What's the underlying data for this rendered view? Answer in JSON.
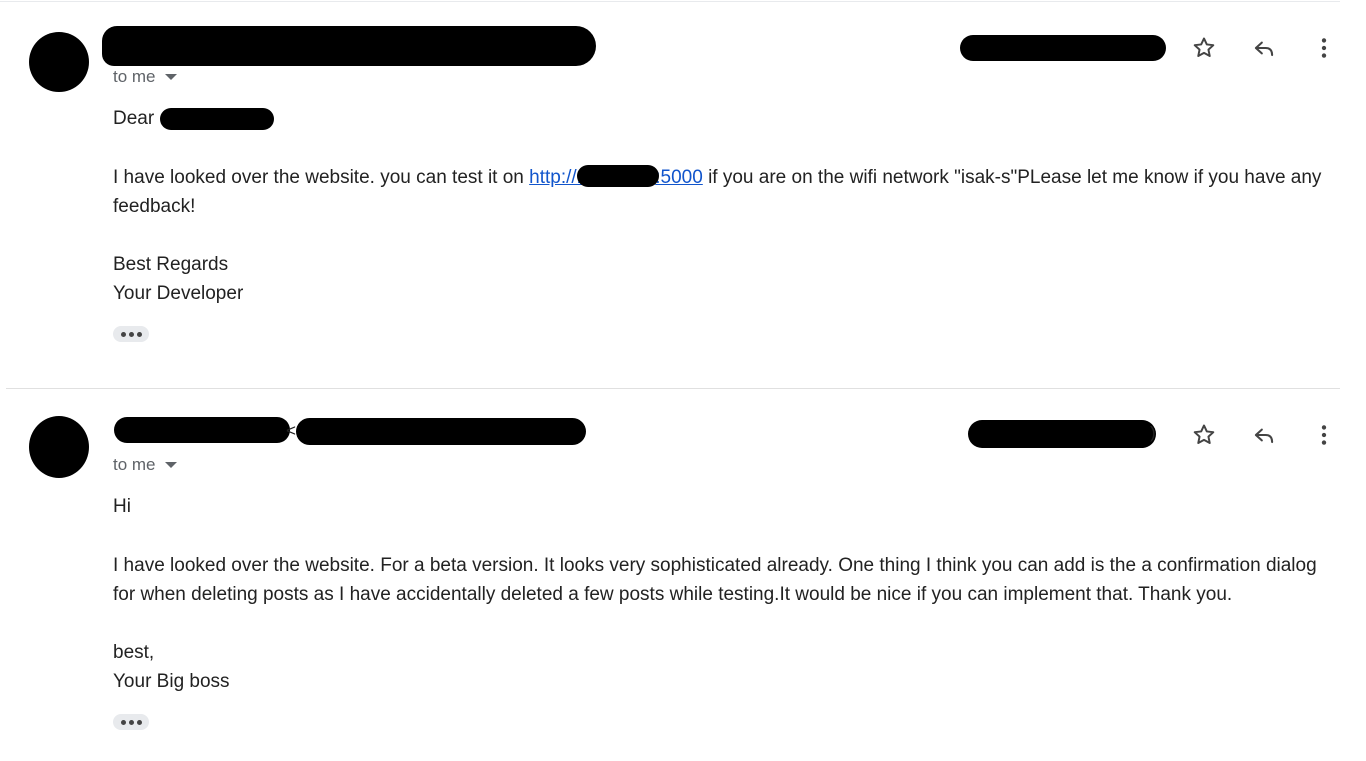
{
  "messages": [
    {
      "recipient_label": "to me",
      "greeting": "Dear",
      "body_before_link": "I have looked over the website. you can test it on ",
      "link_prefix": "http://1",
      "link_suffix": ":5000",
      "body_after_link": "  if you are on the wifi network \"isak-s\"PLease let me know if you have any feedback!",
      "signoff": "Best Regards",
      "signature": "Your Developer"
    },
    {
      "recipient_label": "to me",
      "sender_fragment": "<",
      "date_fragment": ")",
      "greeting": "Hi",
      "body": "I have looked over the website. For a beta version. It looks very sophisticated already. One thing I think you can add is the a confirmation dialog for when deleting posts as I have accidentally deleted a few posts while testing.It would be nice if you can implement that. Thank you.",
      "signoff": "best,",
      "signature": "Your Big boss"
    }
  ],
  "icons": {
    "star": "star-icon",
    "reply": "reply-icon",
    "more": "more-vertical-icon",
    "expand": "ellipsis-icon"
  },
  "colors": {
    "link": "#1155cc",
    "muted_text": "#5f6368",
    "redaction": "#000000"
  }
}
